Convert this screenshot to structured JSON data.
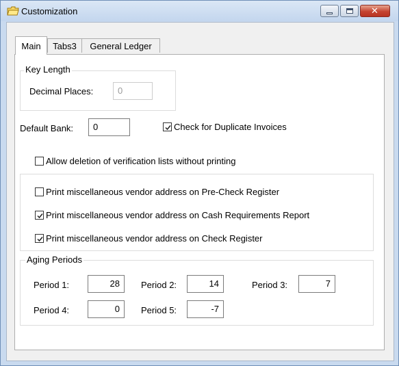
{
  "window": {
    "title": "Customization"
  },
  "tabs": [
    "Main",
    "Tabs3",
    "General Ledger"
  ],
  "key_length": {
    "title": "Key Length",
    "decimal_places_label": "Decimal Places:",
    "decimal_places_value": "0"
  },
  "default_bank": {
    "label": "Default Bank:",
    "value": "0"
  },
  "checks": {
    "duplicate_invoices": {
      "label": "Check for Duplicate Invoices",
      "checked": true
    },
    "allow_deletion": {
      "label": "Allow deletion of verification lists without printing",
      "checked": false
    },
    "pre_check_register": {
      "label": "Print miscellaneous vendor address on Pre-Check Register",
      "checked": false
    },
    "cash_requirements": {
      "label": "Print miscellaneous vendor address on Cash Requirements Report",
      "checked": true
    },
    "check_register": {
      "label": "Print miscellaneous vendor address on Check Register",
      "checked": true
    }
  },
  "aging": {
    "title": "Aging Periods",
    "periods": [
      {
        "label": "Period 1:",
        "value": "28"
      },
      {
        "label": "Period 2:",
        "value": "14"
      },
      {
        "label": "Period 3:",
        "value": "7"
      },
      {
        "label": "Period 4:",
        "value": "0"
      },
      {
        "label": "Period 5:",
        "value": "-7"
      }
    ]
  }
}
